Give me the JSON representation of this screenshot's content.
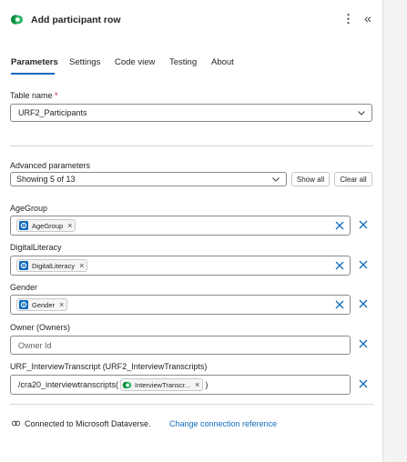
{
  "header": {
    "title": "Add participant row",
    "more_icon": "more-vertical-icon",
    "collapse_icon": "double-chevron-left-icon",
    "app_icon": "dataverse-icon"
  },
  "tabs": [
    {
      "label": "Parameters",
      "active": true
    },
    {
      "label": "Settings",
      "active": false
    },
    {
      "label": "Code view",
      "active": false
    },
    {
      "label": "Testing",
      "active": false
    },
    {
      "label": "About",
      "active": false
    }
  ],
  "table_name": {
    "label": "Table name",
    "required_mark": "*",
    "value": "URF2_Participants"
  },
  "advanced": {
    "label": "Advanced parameters",
    "showing": "Showing 5 of 13",
    "show_all": "Show all",
    "clear_all": "Clear all"
  },
  "fields": {
    "age_group": {
      "label": "AgeGroup",
      "token": "AgeGroup"
    },
    "digital_literacy": {
      "label": "DigitalLiteracy",
      "token": "DigitalLiteracy"
    },
    "gender": {
      "label": "Gender",
      "token": "Gender"
    },
    "owner": {
      "label": "Owner (Owners)",
      "placeholder": "Owner Id"
    },
    "interview": {
      "label": "URF_InterviewTranscript (URF2_InterviewTranscripts)",
      "prefix": "/cra20_interviewtranscripts(",
      "token": "InterviewTranscr...",
      "suffix": ")"
    }
  },
  "footer": {
    "connected_text": "Connected to Microsoft Dataverse.",
    "change_link": "Change connection reference",
    "icon": "connection-icon"
  },
  "colors": {
    "accent": "#0f6cbd",
    "dataverse_green": "#0b8a3a",
    "token_blue": "#0f6cbd",
    "required": "#c50f1f"
  }
}
